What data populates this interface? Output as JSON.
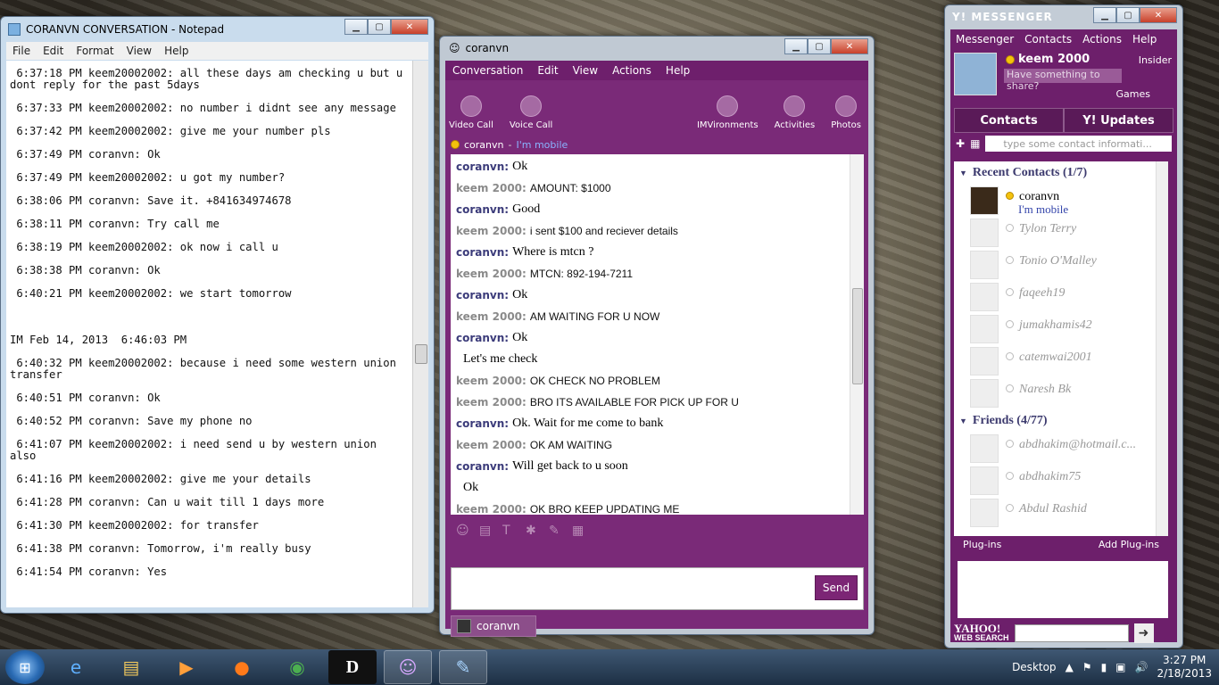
{
  "notepad": {
    "title": "CORANVN CONVERSATION - Notepad",
    "menu": [
      "File",
      "Edit",
      "Format",
      "View",
      "Help"
    ],
    "lines": [
      " 6:37:18 PM keem20002002: all these days am checking u but u dont reply for the past 5days",
      " 6:37:33 PM keem20002002: no number i didnt see any message",
      " 6:37:42 PM keem20002002: give me your number pls",
      " 6:37:49 PM coranvn: Ok",
      " 6:37:49 PM keem20002002: u got my number?",
      " 6:38:06 PM coranvn: Save it. +841634974678",
      " 6:38:11 PM coranvn: Try call me",
      " 6:38:19 PM keem20002002: ok now i call u",
      " 6:38:38 PM coranvn: Ok",
      " 6:40:21 PM keem20002002: we start tomorrow",
      "",
      "IM Feb 14, 2013  6:46:03 PM",
      " 6:40:32 PM keem20002002: because i need some western union transfer",
      " 6:40:51 PM coranvn: Ok",
      " 6:40:52 PM coranvn: Save my phone no",
      " 6:41:07 PM keem20002002: i need send u by western union also",
      " 6:41:16 PM keem20002002: give me your details",
      " 6:41:28 PM coranvn: Can u wait till 1 days more",
      " 6:41:30 PM keem20002002: for transfer",
      " 6:41:38 PM coranvn: Tomorrow, i'm really busy",
      " 6:41:54 PM coranvn: Yes"
    ]
  },
  "conv": {
    "title": "coranvn",
    "menu": [
      "Conversation",
      "Edit",
      "View",
      "Actions",
      "Help"
    ],
    "tools": [
      "Video Call",
      "Voice Call"
    ],
    "tools_right": [
      "IMVironments",
      "Activities",
      "Photos"
    ],
    "contact": "coranvn",
    "contact_status": "I'm mobile",
    "messages": [
      {
        "who": "coranvn:",
        "text": "Ok",
        "type": "c"
      },
      {
        "who": "keem 2000:",
        "text": "AMOUNT: $1000",
        "type": "k"
      },
      {
        "who": "coranvn:",
        "text": "Good",
        "type": "c"
      },
      {
        "who": "keem 2000:",
        "text": "i sent $100 and reciever details",
        "type": "k"
      },
      {
        "who": "coranvn:",
        "text": "Where is mtcn ?",
        "type": "c"
      },
      {
        "who": "keem 2000:",
        "text": "MTCN: 892-194-7211",
        "type": "k"
      },
      {
        "who": "coranvn:",
        "text": "Ok",
        "type": "c"
      },
      {
        "who": "keem 2000:",
        "text": "AM WAITING FOR U NOW",
        "type": "k"
      },
      {
        "who": "coranvn:",
        "text": "Ok",
        "type": "c"
      },
      {
        "who": "",
        "text": "Let's me check",
        "type": "cont"
      },
      {
        "who": "keem 2000:",
        "text": "OK CHECK NO PROBLEM",
        "type": "k"
      },
      {
        "who": "keem 2000:",
        "text": "BRO ITS AVAILABLE FOR PICK UP FOR U",
        "type": "k"
      },
      {
        "who": "coranvn:",
        "text": "Ok. Wait for me come to bank",
        "type": "c"
      },
      {
        "who": "keem 2000:",
        "text": "OK AM WAITING",
        "type": "k"
      },
      {
        "who": "coranvn:",
        "text": "Will get back to u soon",
        "type": "c"
      },
      {
        "who": "",
        "text": "Ok",
        "type": "cont"
      },
      {
        "who": "keem 2000:",
        "text": "OK BRO KEEP UPDATING ME",
        "type": "k"
      }
    ],
    "send": "Send",
    "tab": "coranvn"
  },
  "ym": {
    "title": "Y! MESSENGER",
    "menu": [
      "Messenger",
      "Contacts",
      "Actions",
      "Help"
    ],
    "user": "keem 2000",
    "insider": "Insider",
    "share": "Have something to share?",
    "games": "Games",
    "tab_contacts": "Contacts",
    "tab_updates": "Y! Updates",
    "search_placeholder": "type some contact informati...",
    "recent_header": "Recent Contacts (1/7)",
    "friends_header": "Friends (4/77)",
    "recent": [
      {
        "name": "coranvn",
        "status": "I'm mobile",
        "online": true
      },
      {
        "name": "Tylon Terry"
      },
      {
        "name": "Tonio O'Malley"
      },
      {
        "name": "faqeeh19"
      },
      {
        "name": "jumakhamis42"
      },
      {
        "name": "catemwai2001"
      },
      {
        "name": "Naresh Bk"
      }
    ],
    "friends": [
      {
        "name": "abdhakim@hotmail.c..."
      },
      {
        "name": "abdhakim75"
      },
      {
        "name": "Abdul Rashid"
      }
    ],
    "plugins": "Plug-ins",
    "add_plugins": "Add Plug-ins",
    "yahoo": "YAHOO!",
    "websearch": "WEB SEARCH"
  },
  "taskbar": {
    "desktop": "Desktop",
    "time": "3:27 PM",
    "date": "2/18/2013"
  }
}
